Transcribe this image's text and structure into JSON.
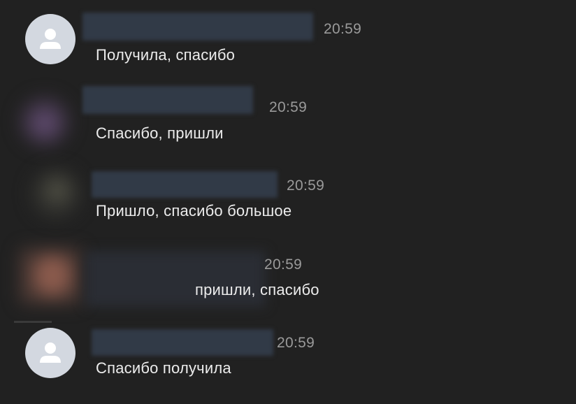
{
  "messages": [
    {
      "time": "20:59",
      "text": "Получила, спасибо",
      "avatar": "person-icon"
    },
    {
      "time": "20:59",
      "text": "Спасибо, пришли",
      "avatar": "blurred-photo"
    },
    {
      "time": "20:59",
      "text": "Пришло, спасибо большое",
      "avatar": "blurred-photo"
    },
    {
      "time": "20:59",
      "text": "пришли, спасибо",
      "avatar": "blurred-photo"
    },
    {
      "time": "20:59",
      "text": "Спасибо получила",
      "avatar": "person-icon"
    }
  ],
  "colors": {
    "background": "#212121",
    "default_avatar": "#d3d8e0",
    "avatar_glyph": "#ffffff",
    "time": "#9a9a9a",
    "text": "#ececec"
  }
}
